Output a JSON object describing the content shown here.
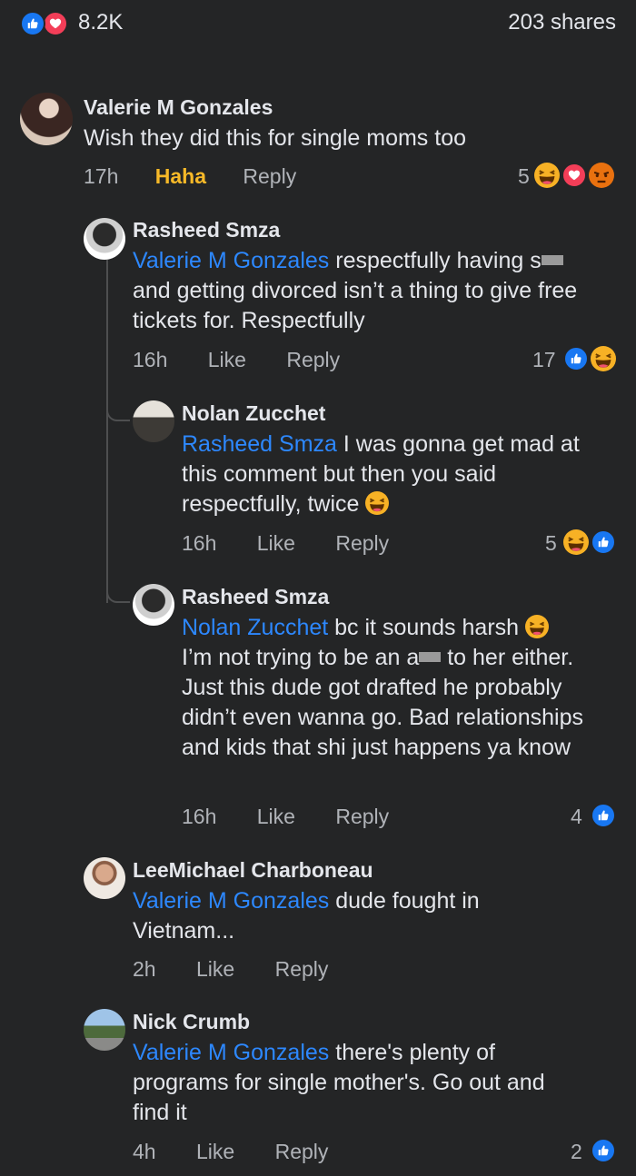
{
  "header": {
    "reaction_count": "8.2K",
    "shares": "203 shares"
  },
  "colors": {
    "background": "#242526",
    "mention": "#2d88ff",
    "haha_label": "#f7b928",
    "like": "#1877f2",
    "love": "#f33e58"
  },
  "comments": [
    {
      "author": "Valerie M Gonzales",
      "text": "Wish they did this for single moms too",
      "time": "17h",
      "action": "Haha",
      "reply": "Reply",
      "reaction_count": "5",
      "reactions": [
        "haha-icon",
        "love-icon",
        "angry-icon"
      ]
    },
    {
      "author": "Rasheed Smza",
      "mention": "Valerie M Gonzales",
      "text_a": " respectfully having s",
      "text_b": "and getting divorced isn’t a thing to give free tickets for. Respectfully",
      "time": "16h",
      "action": "Like",
      "reply": "Reply",
      "reaction_count": "17",
      "reactions": [
        "like-icon",
        "haha-icon"
      ]
    },
    {
      "author": "Nolan Zucchet",
      "mention": "Rasheed Smza",
      "text": " I was gonna get mad at this comment but then you said respectfully, twice",
      "time": "16h",
      "action": "Like",
      "reply": "Reply",
      "reaction_count": "5",
      "reactions": [
        "haha-icon",
        "like-icon"
      ]
    },
    {
      "author": "Rasheed Smza",
      "mention": "Nolan Zucchet",
      "text_a": " bc it sounds harsh",
      "text_b": "I’m not trying to be an a",
      "text_c": " to her either. Just this dude got drafted he probably didn’t even wanna go.  Bad relationships and kids that shi just happens ya know",
      "time": "16h",
      "action": "Like",
      "reply": "Reply",
      "reaction_count": "4",
      "reactions": [
        "like-icon"
      ]
    },
    {
      "author": "LeeMichael Charboneau",
      "mention": "Valerie M Gonzales",
      "text": " dude fought in Vietnam...",
      "time": "2h",
      "action": "Like",
      "reply": "Reply"
    },
    {
      "author": "Nick Crumb",
      "mention": "Valerie M Gonzales",
      "text": " there's plenty of programs for single mother's. Go out and find it",
      "time": "4h",
      "action": "Like",
      "reply": "Reply",
      "reaction_count": "2",
      "reactions": [
        "like-icon"
      ]
    }
  ]
}
